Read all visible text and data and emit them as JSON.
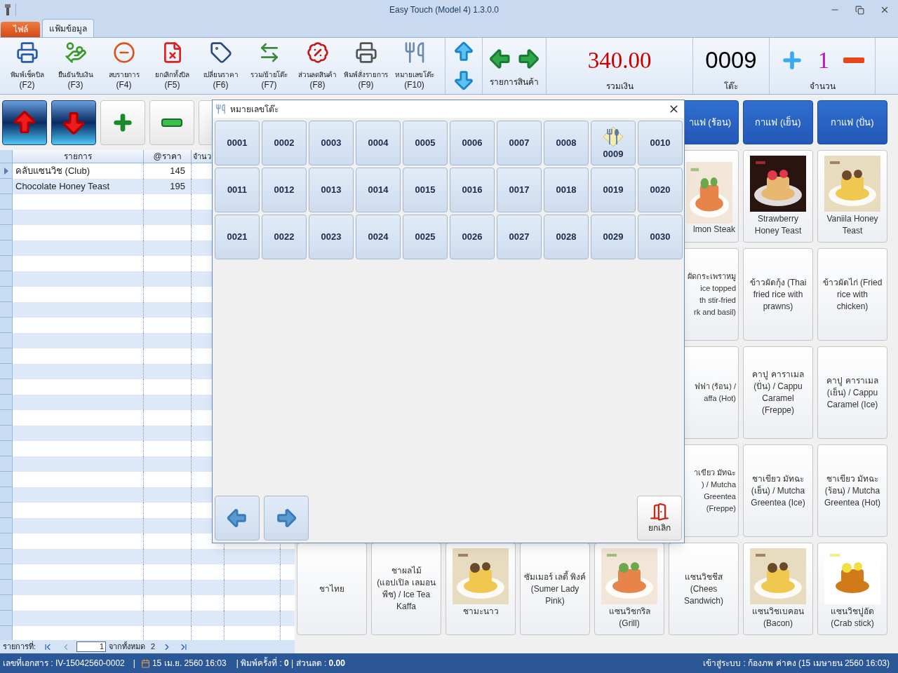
{
  "window": {
    "title": "Easy Touch (Model 4) 1.3.0.0"
  },
  "ribbon_tabs": [
    {
      "label": "ไฟล์",
      "kind": "file",
      "selected": false
    },
    {
      "label": "แฟ้มข้อมูล",
      "kind": "tab",
      "selected": true
    }
  ],
  "toolbar": [
    {
      "label": "พิมพ์เช็คบิล",
      "key": "(F2)",
      "kind": "print-bill"
    },
    {
      "label": "ยืนยันรับเงิน",
      "key": "(F3)",
      "kind": "payment"
    },
    {
      "label": "ลบรายการ",
      "key": "(F4)",
      "kind": "delete"
    },
    {
      "label": "ยกเลิกทั้งบิล",
      "key": "(F5)",
      "kind": "cancel"
    },
    {
      "label": "เปลี่ยนราคา",
      "key": "(F6)",
      "kind": "price"
    },
    {
      "label": "รวม/ย้ายโต๊ะ",
      "key": "(F7)",
      "kind": "move"
    },
    {
      "label": "ส่วนลดสินค้า",
      "key": "(F8)",
      "kind": "discount"
    },
    {
      "label": "พิมพ์สั่งรายการ",
      "key": "(F9)",
      "kind": "print-order"
    },
    {
      "label": "หมายเลขโต๊ะ",
      "key": "(F10)",
      "kind": "table"
    }
  ],
  "product_nav": {
    "label": "รายการสินค้า"
  },
  "total": {
    "value": "340.00",
    "label": "รวมเงิน"
  },
  "table": {
    "value": "0009",
    "label": "โต๊ะ"
  },
  "quantity": {
    "value": "1",
    "label": "จำนวน"
  },
  "order_grid": {
    "columns": [
      "รายการ",
      "@ราคา",
      "จำนว"
    ],
    "rows": [
      {
        "item": "คลับแซนวิช (Club)",
        "price": "145",
        "current": true
      },
      {
        "item": "Chocolate Honey Teast",
        "price": "195",
        "current": false
      }
    ]
  },
  "pager": {
    "label": "รายการที่:",
    "value": "1",
    "of_label": "จากทั้งหมด",
    "total": "2"
  },
  "categories": [
    {
      "label": "าแฟ (ร้อน)",
      "partial": true
    },
    {
      "label": "กาแฟ (เย็น)",
      "partial": false
    },
    {
      "label": "กาแฟ (ปั่น)",
      "partial": false
    }
  ],
  "product_rows": [
    [
      {
        "kind": "cut_picture",
        "lines": [
          "lmon Steak"
        ]
      },
      {
        "kind": "picture",
        "text": "Strawberry Honey Teast"
      },
      {
        "kind": "picture",
        "text": "Vaniila Honey Teast"
      }
    ],
    [
      {
        "kind": "cut_text",
        "lines": [
          "ผัดกระเพราหมู",
          "ice topped",
          "th stir-fried",
          "rk and basil)"
        ]
      },
      {
        "kind": "text",
        "text": "ข้าวผัดกุ้ง (Thai fried rice with prawns)"
      },
      {
        "kind": "text",
        "text": "ข้าวผัดไก่ (Fried rice with chicken)"
      }
    ],
    [
      {
        "kind": "cut_text",
        "lines": [
          "ฟฟา (ร้อน) /",
          "affa (Hot)"
        ]
      },
      {
        "kind": "text",
        "text": "คาปู คาราเมล (ปั่น) / Cappu Caramel (Freppe)"
      },
      {
        "kind": "text",
        "text": "คาปู คาราเมล (เย็น) / Cappu Caramel (Ice)"
      }
    ],
    [
      {
        "kind": "cut_text",
        "lines": [
          "าเขียว มัทฉะ",
          ") / Mutcha",
          "Greentea",
          "(Freppe)"
        ]
      },
      {
        "kind": "text",
        "text": "ชาเขียว มัทฉะ (เย็น) / Mutcha Greentea (Ice)"
      },
      {
        "kind": "text",
        "text": "ชาเขียว มัทฉะ (ร้อน) / Mutcha Greentea (Hot)"
      }
    ]
  ],
  "bottom_products": [
    {
      "kind": "text",
      "text": "ชาไทย"
    },
    {
      "kind": "text",
      "text": "ชาผลไม้ (แอปเปิล เลมอน พีช) / Ice Tea Kaffa"
    },
    {
      "kind": "picture",
      "text": "ชามะนาว"
    },
    {
      "kind": "text",
      "text": "ซัมเมอร์ เลดี้ พิงค์ (Sumer Lady Pink)"
    },
    {
      "kind": "picture",
      "text": "แซนวิชกริล (Grill)"
    },
    {
      "kind": "text",
      "text": "แซนวิชชีส (Chees Sandwich)"
    },
    {
      "kind": "picture",
      "text": "แซนวิชเบคอน (Bacon)"
    },
    {
      "kind": "picture",
      "text": "แซนวิชปูอัด (Crab stick)"
    }
  ],
  "dialog": {
    "title": "หมายเลขโต๊ะ",
    "cancel": "ยกเลิก",
    "tables": [
      {
        "label": "0001",
        "selected": false
      },
      {
        "label": "0002",
        "selected": false
      },
      {
        "label": "0003",
        "selected": false
      },
      {
        "label": "0004",
        "selected": false
      },
      {
        "label": "0005",
        "selected": false
      },
      {
        "label": "0006",
        "selected": false
      },
      {
        "label": "0007",
        "selected": false
      },
      {
        "label": "0008",
        "selected": false
      },
      {
        "label": "0009",
        "selected": true
      },
      {
        "label": "0010",
        "selected": false
      },
      {
        "label": "0011",
        "selected": false
      },
      {
        "label": "0012",
        "selected": false
      },
      {
        "label": "0013",
        "selected": false
      },
      {
        "label": "0014",
        "selected": false
      },
      {
        "label": "0015",
        "selected": false
      },
      {
        "label": "0016",
        "selected": false
      },
      {
        "label": "0017",
        "selected": false
      },
      {
        "label": "0018",
        "selected": false
      },
      {
        "label": "0019",
        "selected": false
      },
      {
        "label": "0020",
        "selected": false
      },
      {
        "label": "0021",
        "selected": false
      },
      {
        "label": "0022",
        "selected": false
      },
      {
        "label": "0023",
        "selected": false
      },
      {
        "label": "0024",
        "selected": false
      },
      {
        "label": "0025",
        "selected": false
      },
      {
        "label": "0026",
        "selected": false
      },
      {
        "label": "0027",
        "selected": false
      },
      {
        "label": "0028",
        "selected": false
      },
      {
        "label": "0029",
        "selected": false
      },
      {
        "label": "0030",
        "selected": false
      }
    ]
  },
  "status_bar": {
    "document": "เลขที่เอกสาร : IV-15042560-0002",
    "separator": "|",
    "date": "15 เม.ย. 2560 16:03",
    "info": "| พิมพ์ครั้งที่ : **0** | ส่วนลด : **0.00**",
    "login": "เข้าสู่ระบบ : ก้องภพ ค่าคง (15 เมษายน 2560 16:03)"
  }
}
